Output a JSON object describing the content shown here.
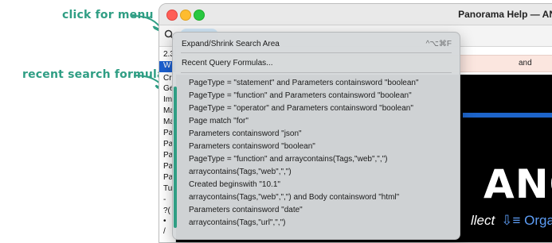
{
  "annotations": {
    "click_for_menu": "click for menu",
    "recent_search_formulas": "recent search formulas"
  },
  "window": {
    "title": "Panorama Help — AN"
  },
  "sidebar": {
    "items": [
      "2.3",
      "W",
      "Cr",
      "Ge",
      "Im",
      "Ma",
      "Ma",
      "Pa",
      "Pa",
      "Pa",
      "Pa",
      "Pa",
      "Tu",
      "-",
      "?(",
      "•",
      "/"
    ]
  },
  "content": {
    "header_cell": "and",
    "banner_big": "ANO",
    "banner_small": "llect",
    "banner_org": "⇩≡ Orga"
  },
  "menu": {
    "expand": {
      "label": "Expand/Shrink Search Area",
      "shortcut": "^⌥⌘F"
    },
    "recent_header": "Recent Query Formulas...",
    "formulas": [
      "PageType = \"statement\" and Parameters containsword \"boolean\"",
      "PageType = \"function\" and Parameters containsword \"boolean\"",
      "PageType = \"operator\" and Parameters containsword \"boolean\"",
      "Page match \"for\"",
      "Parameters containsword \"json\"",
      "Parameters containsword \"boolean\"",
      "PageType = \"function\" and arraycontains(Tags,\"web\",\",\")",
      "arraycontains(Tags,\"web\",\",\")",
      "Created beginswith \"10.1\"",
      "arraycontains(Tags,\"web\",\",\") and Body containsword \"html\"",
      "Parameters containsword \"date\"",
      "arraycontains(Tags,\"url\",\",\")"
    ]
  },
  "colors": {
    "annotation": "#2f9e84",
    "selection": "#1b5fcf",
    "search_pill": "#cde3f3"
  }
}
